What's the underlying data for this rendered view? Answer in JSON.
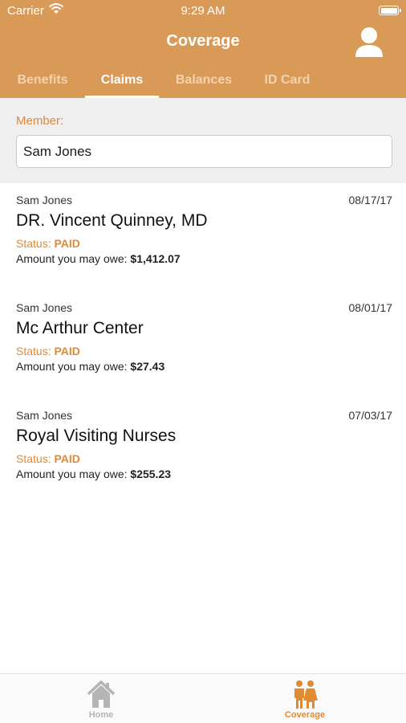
{
  "status_bar": {
    "carrier": "Carrier",
    "time": "9:29 AM"
  },
  "header": {
    "title": "Coverage"
  },
  "tabs": [
    {
      "label": "Benefits",
      "active": false
    },
    {
      "label": "Claims",
      "active": true
    },
    {
      "label": "Balances",
      "active": false
    },
    {
      "label": "ID Card",
      "active": false
    }
  ],
  "member": {
    "label": "Member:",
    "value": "Sam Jones"
  },
  "claims": [
    {
      "member": "Sam Jones",
      "date": "08/17/17",
      "provider": "DR. Vincent Quinney, MD",
      "status_label": "Status: ",
      "status": "PAID",
      "owe_label": "Amount you may owe: ",
      "owe": "$1,412.07"
    },
    {
      "member": "Sam Jones",
      "date": "08/01/17",
      "provider": "Mc Arthur Center",
      "status_label": "Status: ",
      "status": "PAID",
      "owe_label": "Amount you may owe: ",
      "owe": "$27.43"
    },
    {
      "member": "Sam Jones",
      "date": "07/03/17",
      "provider": "Royal Visiting Nurses",
      "status_label": "Status: ",
      "status": "PAID",
      "owe_label": "Amount you may owe: ",
      "owe": "$255.23"
    }
  ],
  "tabbar": [
    {
      "label": "Home",
      "icon": "home-icon",
      "active": false
    },
    {
      "label": "Coverage",
      "icon": "family-icon",
      "active": true
    }
  ],
  "colors": {
    "brand": "#d99a57",
    "accent": "#e08a33",
    "tab_inactive": "#f3d3ad",
    "tabbar_inactive": "#b5b5b5"
  }
}
